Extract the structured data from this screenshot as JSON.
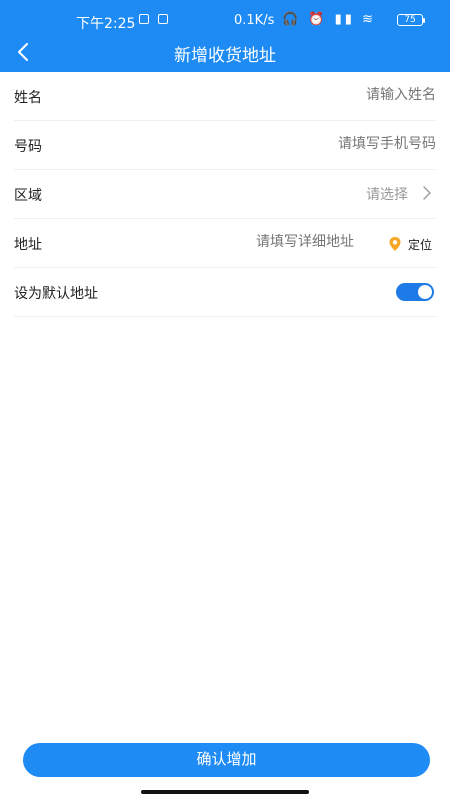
{
  "status_bar": {
    "time": "下午2:25",
    "network_speed": "0.1K/s",
    "battery": "75",
    "icons": [
      "headset-icon",
      "alarm-icon",
      "hd-signal-icon",
      "signal-icon",
      "wifi-icon"
    ]
  },
  "nav": {
    "title": "新增收货地址",
    "back_icon": "back-chevron-icon"
  },
  "form": {
    "name": {
      "label": "姓名",
      "placeholder": "请输入姓名"
    },
    "phone": {
      "label": "号码",
      "placeholder": "请填写手机号码"
    },
    "region": {
      "label": "区域",
      "placeholder": "请选择"
    },
    "address": {
      "label": "地址",
      "placeholder": "请填写详细地址",
      "locate_label": "定位"
    },
    "default": {
      "label": "设为默认地址",
      "enabled": true
    }
  },
  "actions": {
    "confirm_label": "确认增加"
  },
  "colors": {
    "primary": "#1e8bf4",
    "locate_pin": "#f5a623",
    "toggle_on": "#1e7ae6"
  }
}
